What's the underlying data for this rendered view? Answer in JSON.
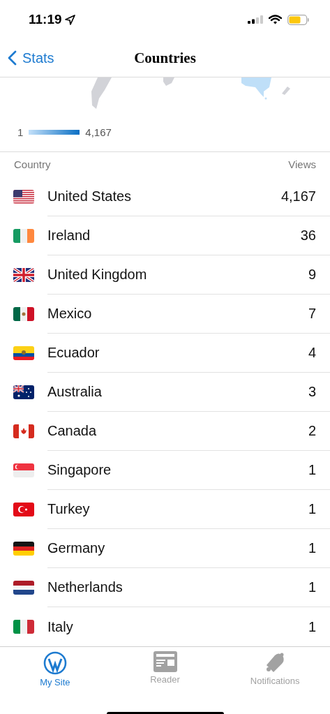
{
  "status_bar": {
    "time": "11:19"
  },
  "nav": {
    "back_label": "Stats",
    "title": "Countries"
  },
  "map": {
    "kind": "picture",
    "legend_min": "1",
    "legend_max": "4,167"
  },
  "table": {
    "columns": [
      "Country",
      "Views"
    ],
    "rows": [
      {
        "country": "United States",
        "views": "4,167"
      },
      {
        "country": "Ireland",
        "views": "36"
      },
      {
        "country": "United Kingdom",
        "views": "9"
      },
      {
        "country": "Mexico",
        "views": "7"
      },
      {
        "country": "Ecuador",
        "views": "4"
      },
      {
        "country": "Australia",
        "views": "3"
      },
      {
        "country": "Canada",
        "views": "2"
      },
      {
        "country": "Singapore",
        "views": "1"
      },
      {
        "country": "Turkey",
        "views": "1"
      },
      {
        "country": "Germany",
        "views": "1"
      },
      {
        "country": "Netherlands",
        "views": "1"
      },
      {
        "country": "Italy",
        "views": "1"
      }
    ]
  },
  "tabs": [
    {
      "label": "My Site",
      "selected": true
    },
    {
      "label": "Reader",
      "selected": false
    },
    {
      "label": "Notifications",
      "selected": false
    }
  ]
}
